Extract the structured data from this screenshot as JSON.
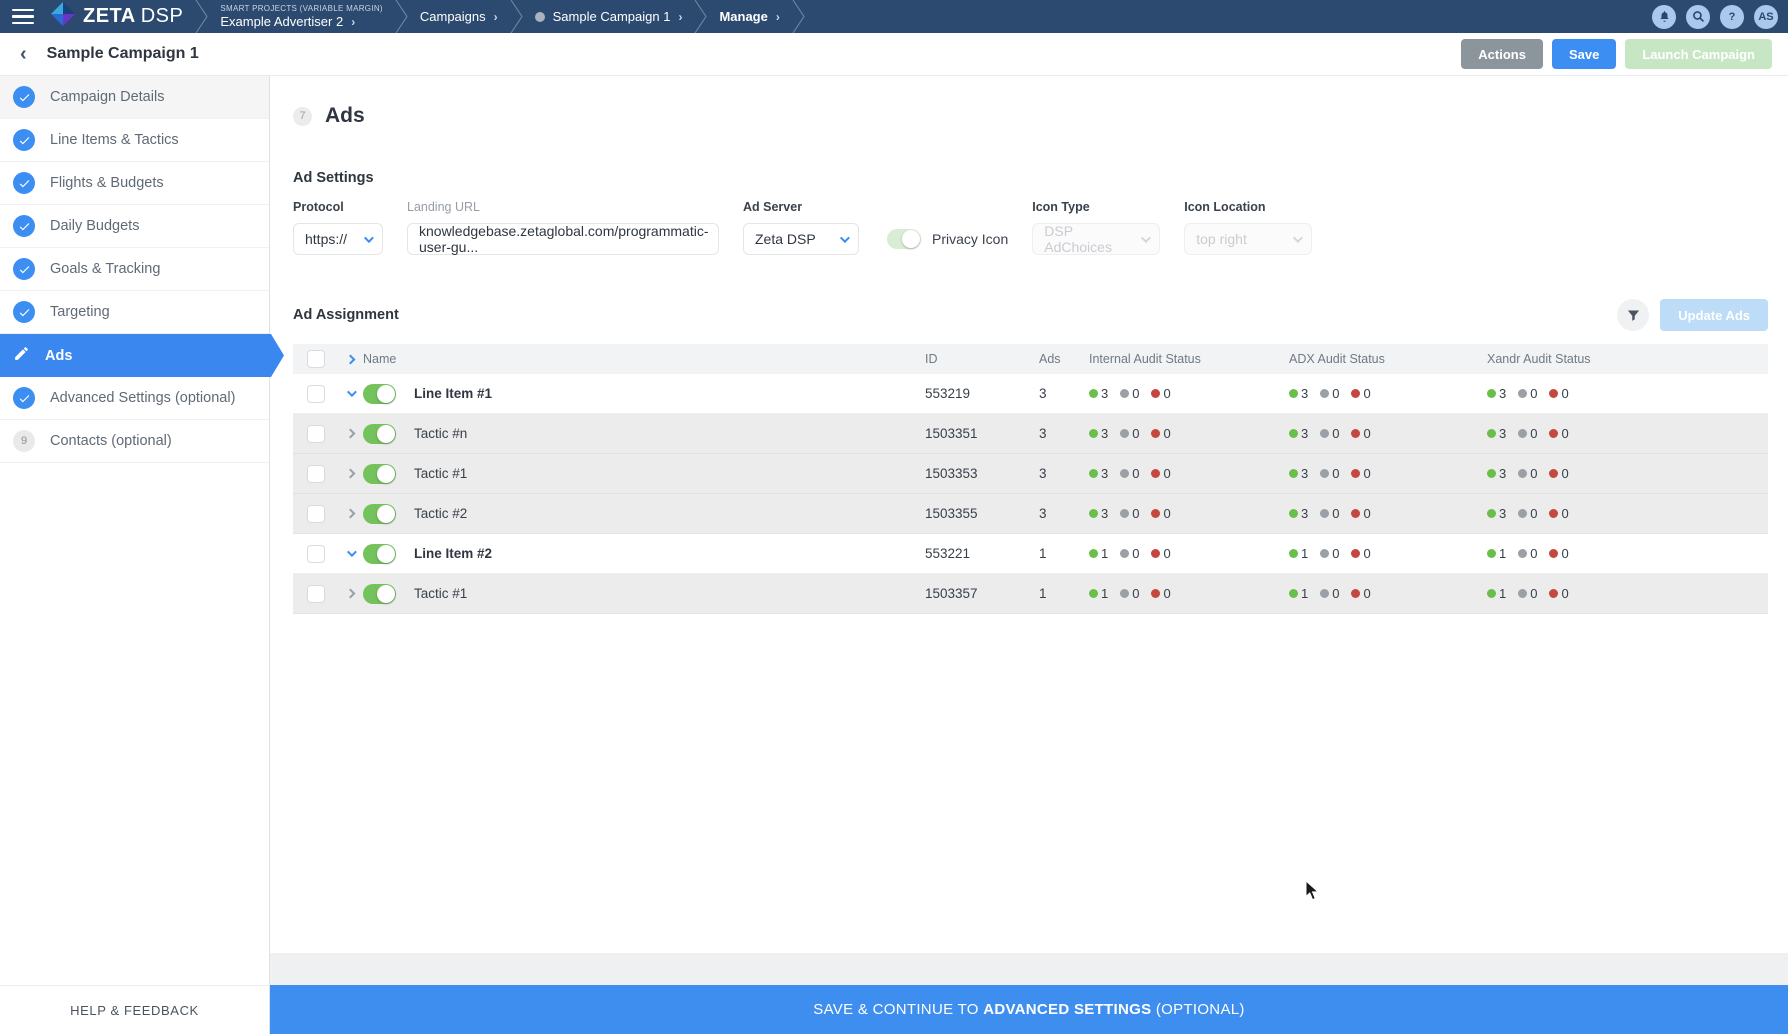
{
  "colors": {
    "accent_blue": "#3d8ef2",
    "navbar_bg": "#2c4a70",
    "toggle_green": "#74c25c",
    "status_approved": "#6abf4b",
    "status_pending": "#9aa0a6",
    "status_rejected": "#c5473f",
    "launch_disabled_green": "#c7e6c3",
    "update_disabled_blue": "#bcdcf8"
  },
  "navbar": {
    "logo": {
      "zeta": "ZETA",
      "dsp": "DSP"
    },
    "breadcrumbs": [
      {
        "eyebrow": "SMART PROJECTS (VARIABLE MARGIN)",
        "label": "Example Advertiser 2"
      },
      {
        "label": "Campaigns"
      },
      {
        "label": "Sample Campaign 1",
        "dot": true
      },
      {
        "label": "Manage",
        "bold": true
      }
    ],
    "avatar": "AS",
    "help_glyph": "?"
  },
  "subheader": {
    "title": "Sample Campaign 1",
    "actions_label": "Actions",
    "save_label": "Save",
    "launch_label": "Launch Campaign"
  },
  "sidebar": {
    "items": [
      {
        "label": "Campaign Details",
        "state": "done"
      },
      {
        "label": "Line Items & Tactics",
        "state": "done"
      },
      {
        "label": "Flights & Budgets",
        "state": "done"
      },
      {
        "label": "Daily Budgets",
        "state": "done"
      },
      {
        "label": "Goals & Tracking",
        "state": "done"
      },
      {
        "label": "Targeting",
        "state": "done"
      },
      {
        "label": "Ads",
        "state": "active"
      },
      {
        "label": "Advanced Settings (optional)",
        "state": "done"
      },
      {
        "label": "Contacts (optional)",
        "state": "number",
        "number": "9"
      }
    ],
    "footer": "HELP & FEEDBACK"
  },
  "main": {
    "step_badge": "7",
    "title": "Ads",
    "ad_settings": {
      "heading": "Ad Settings",
      "protocol": {
        "label": "Protocol",
        "value": "https://"
      },
      "landing_url": {
        "label": "Landing URL",
        "value": "knowledgebase.zetaglobal.com/programmatic-user-gu..."
      },
      "ad_server": {
        "label": "Ad Server",
        "value": "Zeta DSP"
      },
      "privacy_icon": {
        "label": "Privacy Icon",
        "enabled": true
      },
      "icon_type": {
        "label": "Icon Type",
        "value": "DSP AdChoices",
        "disabled": true
      },
      "icon_location": {
        "label": "Icon Location",
        "value": "top right",
        "disabled": true
      }
    },
    "ad_assignment": {
      "heading": "Ad Assignment",
      "update_button": "Update Ads",
      "table": {
        "columns": [
          "Name",
          "ID",
          "Ads",
          "Internal Audit Status",
          "ADX Audit Status",
          "Xandr Audit Status"
        ],
        "rows": [
          {
            "name": "Line Item #1",
            "type": "line-item",
            "id": "553219",
            "ads": "3",
            "internal": [
              3,
              0,
              0
            ],
            "adx": [
              3,
              0,
              0
            ],
            "xandr": [
              3,
              0,
              0
            ],
            "enabled": true
          },
          {
            "name": "Tactic #n",
            "type": "tactic",
            "id": "1503351",
            "ads": "3",
            "internal": [
              3,
              0,
              0
            ],
            "adx": [
              3,
              0,
              0
            ],
            "xandr": [
              3,
              0,
              0
            ],
            "enabled": true
          },
          {
            "name": "Tactic #1",
            "type": "tactic",
            "id": "1503353",
            "ads": "3",
            "internal": [
              3,
              0,
              0
            ],
            "adx": [
              3,
              0,
              0
            ],
            "xandr": [
              3,
              0,
              0
            ],
            "enabled": true
          },
          {
            "name": "Tactic #2",
            "type": "tactic",
            "id": "1503355",
            "ads": "3",
            "internal": [
              3,
              0,
              0
            ],
            "adx": [
              3,
              0,
              0
            ],
            "xandr": [
              3,
              0,
              0
            ],
            "enabled": true
          },
          {
            "name": "Line Item #2",
            "type": "line-item",
            "id": "553221",
            "ads": "1",
            "internal": [
              1,
              0,
              0
            ],
            "adx": [
              1,
              0,
              0
            ],
            "xandr": [
              1,
              0,
              0
            ],
            "enabled": true
          },
          {
            "name": "Tactic #1",
            "type": "tactic",
            "id": "1503357",
            "ads": "1",
            "internal": [
              1,
              0,
              0
            ],
            "adx": [
              1,
              0,
              0
            ],
            "xandr": [
              1,
              0,
              0
            ],
            "enabled": true
          }
        ]
      }
    },
    "footer_bar": {
      "prefix": "SAVE & CONTINUE TO ",
      "emphasis": "ADVANCED SETTINGS",
      "suffix": " (OPTIONAL)"
    }
  }
}
